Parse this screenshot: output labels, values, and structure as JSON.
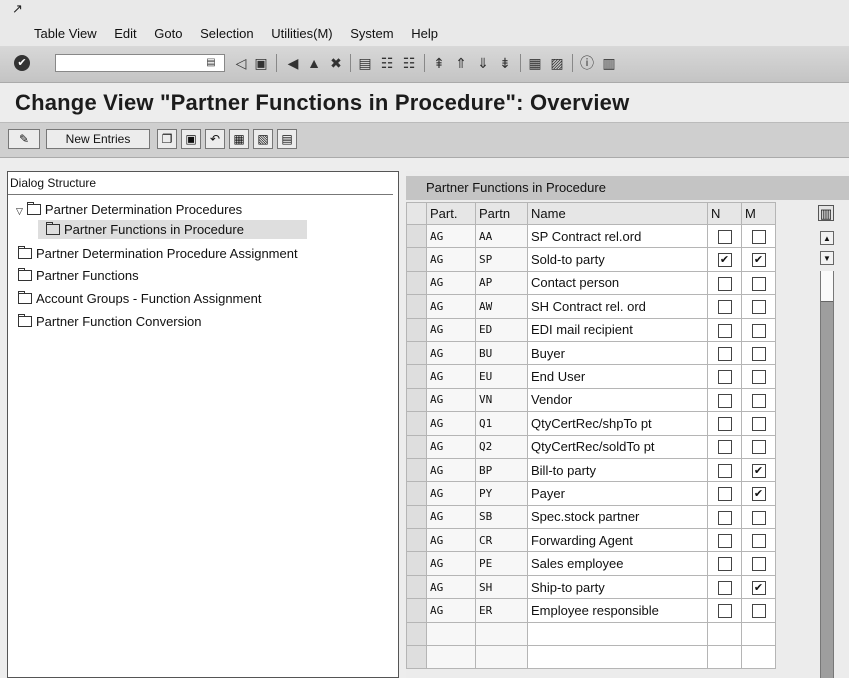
{
  "menubar": {
    "icon": "menu-arrow-icon",
    "items": [
      "Table View",
      "Edit",
      "Goto",
      "Selection",
      "Utilities(M)",
      "System",
      "Help"
    ]
  },
  "toolbar": {
    "command_value": "",
    "icons": [
      "enter-icon",
      "save-icon",
      "back-icon",
      "exit-icon",
      "cancel-icon",
      "print-icon",
      "find-icon",
      "find-next-icon",
      "first-page-icon",
      "previous-page-icon",
      "next-page-icon",
      "last-page-icon",
      "create-session-icon",
      "shortcut-icon",
      "help-icon",
      "layout-icon"
    ]
  },
  "page": {
    "title": "Change View \"Partner Functions in Procedure\": Overview"
  },
  "app_toolbar": {
    "new_entries_label": "New Entries",
    "icons": [
      "change-display-icon",
      "copy-icon",
      "delete-icon",
      "undo-icon",
      "select-all-icon",
      "select-block-icon",
      "deselect-all-icon"
    ]
  },
  "tree": {
    "header": "Dialog Structure",
    "nodes": [
      {
        "label": "Partner Determination Procedures",
        "expanded": true
      },
      {
        "label": "Partner Functions in Procedure",
        "selected": true
      },
      {
        "label": "Partner Determination Procedure Assignment"
      },
      {
        "label": "Partner Functions"
      },
      {
        "label": "Account Groups - Function Assignment"
      },
      {
        "label": "Partner Function Conversion"
      }
    ]
  },
  "grid": {
    "title": "Partner Functions in Procedure",
    "columns": [
      "Part.",
      "Partn",
      "Name",
      "N",
      "M"
    ],
    "rows": [
      {
        "part": "AG",
        "partn": "AA",
        "name": "SP Contract rel.ord",
        "n": false,
        "m": false
      },
      {
        "part": "AG",
        "partn": "SP",
        "name": "Sold-to party",
        "n": true,
        "m": true
      },
      {
        "part": "AG",
        "partn": "AP",
        "name": "Contact person",
        "n": false,
        "m": false
      },
      {
        "part": "AG",
        "partn": "AW",
        "name": "SH Contract rel. ord",
        "n": false,
        "m": false
      },
      {
        "part": "AG",
        "partn": "ED",
        "name": "EDI mail recipient",
        "n": false,
        "m": false
      },
      {
        "part": "AG",
        "partn": "BU",
        "name": "Buyer",
        "n": false,
        "m": false
      },
      {
        "part": "AG",
        "partn": "EU",
        "name": "End User",
        "n": false,
        "m": false
      },
      {
        "part": "AG",
        "partn": "VN",
        "name": "Vendor",
        "n": false,
        "m": false
      },
      {
        "part": "AG",
        "partn": "Q1",
        "name": "QtyCertRec/shpTo pt",
        "n": false,
        "m": false
      },
      {
        "part": "AG",
        "partn": "Q2",
        "name": "QtyCertRec/soldTo pt",
        "n": false,
        "m": false
      },
      {
        "part": "AG",
        "partn": "BP",
        "name": "Bill-to party",
        "n": false,
        "m": true
      },
      {
        "part": "AG",
        "partn": "PY",
        "name": "Payer",
        "n": false,
        "m": true
      },
      {
        "part": "AG",
        "partn": "SB",
        "name": "Spec.stock partner",
        "n": false,
        "m": false
      },
      {
        "part": "AG",
        "partn": "CR",
        "name": "Forwarding Agent",
        "n": false,
        "m": false
      },
      {
        "part": "AG",
        "partn": "PE",
        "name": "Sales employee",
        "n": false,
        "m": false
      },
      {
        "part": "AG",
        "partn": "SH",
        "name": "Ship-to party",
        "n": false,
        "m": true
      },
      {
        "part": "AG",
        "partn": "ER",
        "name": "Employee responsible",
        "n": false,
        "m": false
      }
    ]
  }
}
